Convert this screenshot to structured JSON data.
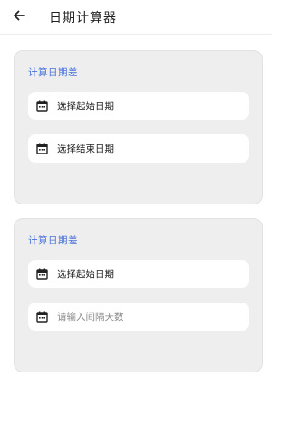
{
  "app_bar": {
    "back_icon": "arrow-left-icon",
    "title": "日期计算器"
  },
  "cards": [
    {
      "title": "计算日期差",
      "fields": [
        {
          "icon": "calendar-icon",
          "label": "选择起始日期"
        },
        {
          "icon": "calendar-icon",
          "label": "选择结束日期"
        }
      ]
    },
    {
      "title": "计算日期差",
      "fields": [
        {
          "icon": "calendar-icon",
          "label": "选择起始日期"
        },
        {
          "icon": "calendar-icon",
          "placeholder": "请输入间隔天数",
          "value": ""
        }
      ]
    }
  ],
  "colors": {
    "accent": "#4a72d8",
    "card_bg": "#eeeeee",
    "field_bg": "#ffffff"
  }
}
